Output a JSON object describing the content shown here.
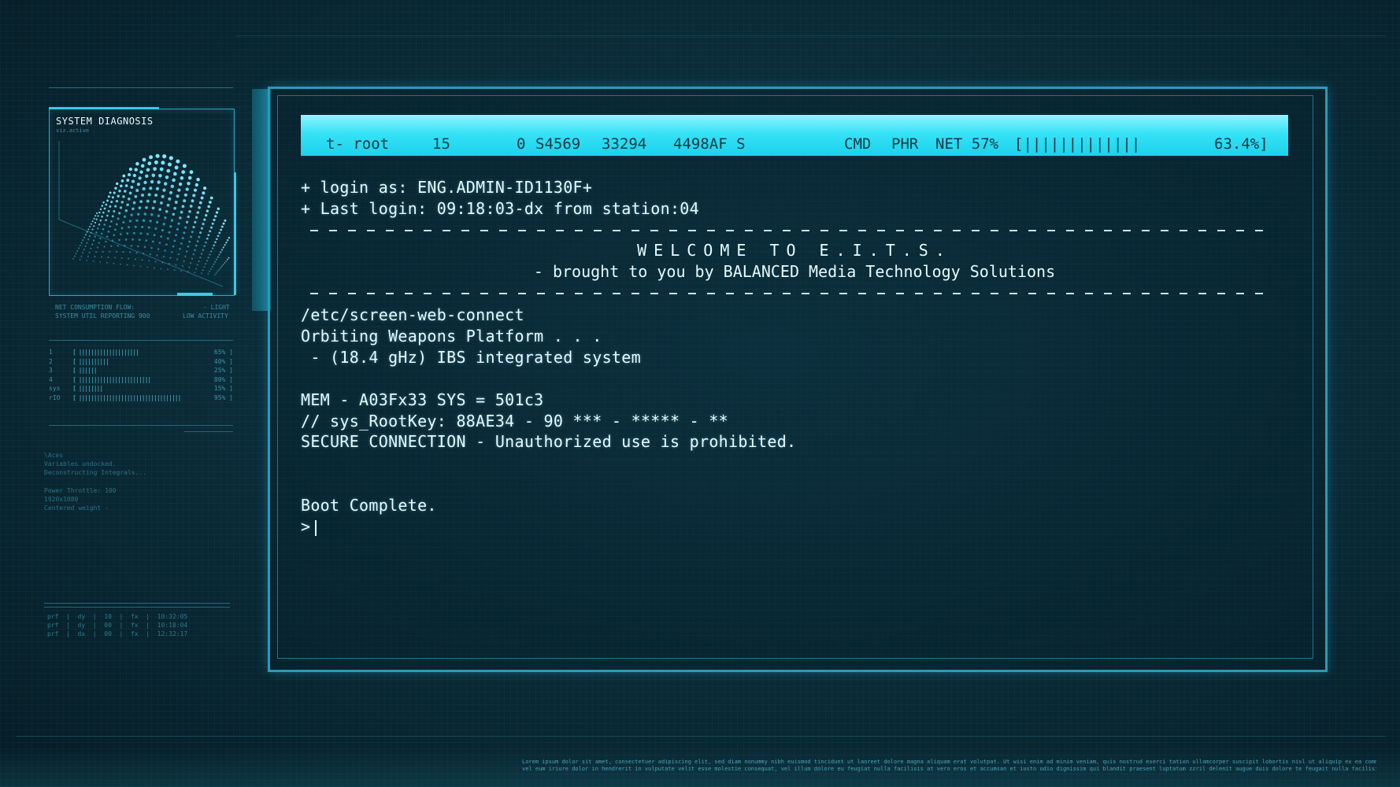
{
  "diagnosis_panel": {
    "title": "SYSTEM DIAGNOSIS",
    "subtitle": "viz.active",
    "footer_left_1": "NET CONSUMPTION FLOW:",
    "footer_left_2": "SYSTEM UTIL REPORTING 900",
    "footer_right_1": "- LIGHT",
    "footer_right_2": "LOW ACTIVITY"
  },
  "util_rows": [
    {
      "label": "1",
      "bars": "[ ||||||||||||||||||||",
      "pct": "65% ]"
    },
    {
      "label": "2",
      "bars": "[ ||||||||||",
      "pct": "40% ]"
    },
    {
      "label": "3",
      "bars": "[ ||||||",
      "pct": "25% ]"
    },
    {
      "label": "4",
      "bars": "[ ||||||||||||||||||||||||",
      "pct": "80% ]"
    },
    {
      "label": "sys",
      "bars": "[ ||||||||",
      "pct": "15% ]"
    },
    {
      "label": "rIO",
      "bars": "[ ||||||||||||||||||||||||||||||||||",
      "pct": "95% ]"
    }
  ],
  "notes": {
    "block1": "\\Aces\nVariables undocked.\nDeconstructing Integrals...",
    "block2": "Power Throttle: 100\n1920x1080\nCentered weight -"
  },
  "perf_lines": [
    "prf  |  dy  |  10  |  fx  |  10:32:05",
    "prf  |  dy  |  00  |  fx  |  10:18:04",
    "prf  |  dx  |  00  |  fx  |  12:32:17"
  ],
  "status_bar": {
    "user": "t- root",
    "pr": "15",
    "ni": "0",
    "virt": "S4569",
    "res": "33294",
    "shr": "4498AF S",
    "cmd": "CMD",
    "phr": "PHR",
    "net": "NET 57%",
    "meter": "[|||||||||||||",
    "meter_pct": "63.4%]"
  },
  "terminal": {
    "login_line": "+ login as: ENG.ADMIN-ID1130F+",
    "last_login_line": "+ Last login: 09:18:03-dx from station:04",
    "welcome": "WELCOME TO E.I.T.S.",
    "brought_by": "- brought to you by BALANCED Media Technology Solutions",
    "path_line": "/etc/screen-web-connect",
    "platform_line": "Orbiting Weapons Platform . . .",
    "system_line": " - (18.4 gHz) IBS integrated system",
    "mem_line": "MEM - A03Fx33 SYS = 501c3",
    "rootkey_line": "// sys_RootKey: 88AE34 - 90 *** - ***** - **",
    "secure_line": "SECURE CONNECTION - Unauthorized use is prohibited.",
    "boot_line": "Boot Complete.",
    "prompt": ">"
  },
  "footer_text": {
    "line1": "Lorem ipsum dolor sit amet, consectetuer adipiscing elit, sed diam nonummy nibh euismod tincidunt ut laoreet dolore magna aliquam erat volutpat. Ut wisi enim ad minim veniam, quis nostrud exerci tation ullamcorper suscipit lobortis nisl ut aliquip ex ea commodo consequat. Duis autem",
    "line2": "vel eum iriure dolor in hendrerit in vulputate velit esse molestie consequat, vel illum dolore eu feugiat nulla facilisis at vero eros et accumsan et iusto odio dignissim qui blandit praesent luptatum zzril delenit augue duis dolore te feugait nulla facilisi."
  }
}
